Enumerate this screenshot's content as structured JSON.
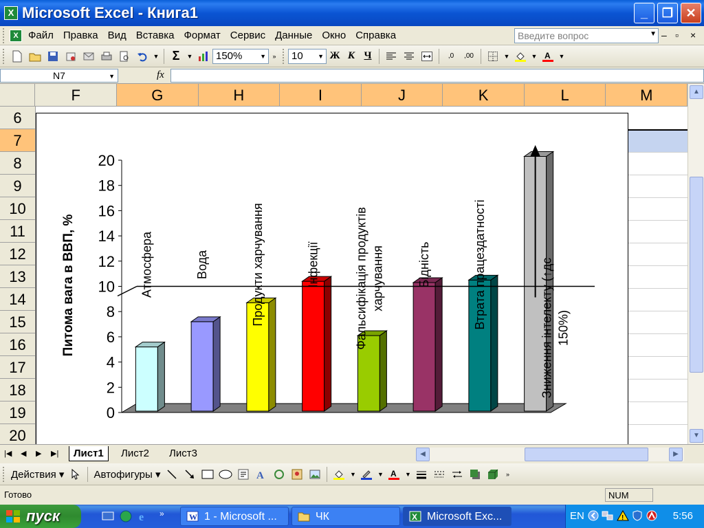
{
  "window": {
    "title": "Microsoft Excel - Книга1",
    "min": "_",
    "max": "❐",
    "close": "✕"
  },
  "menu": {
    "items": [
      "Файл",
      "Правка",
      "Вид",
      "Вставка",
      "Формат",
      "Сервис",
      "Данные",
      "Окно",
      "Справка"
    ],
    "help_placeholder": "Введите вопрос"
  },
  "toolbar": {
    "zoom": "150%",
    "font_size": "10",
    "bold": "Ж",
    "italic": "К",
    "underline": "Ч",
    "sum": "Σ"
  },
  "formula_bar": {
    "name_box": "N7",
    "fx": "fx",
    "formula": ""
  },
  "grid": {
    "columns": [
      "F",
      "G",
      "H",
      "I",
      "J",
      "K",
      "L",
      "M"
    ],
    "rows": [
      "6",
      "7",
      "8",
      "9",
      "10",
      "11",
      "12",
      "13",
      "14",
      "15",
      "16",
      "17",
      "18",
      "19",
      "20"
    ],
    "selected_row": "7"
  },
  "chart_data": {
    "type": "bar",
    "categories": [
      "Атмосфера",
      "Вода",
      "Продукти харчування",
      "Інфекції",
      "Фальсифікація продуктів харчування",
      "Бідність",
      "Втрата працездатності",
      "Зниження інтелекту (↑дс 150%)"
    ],
    "category_label_lines": [
      [
        "Атмосфера"
      ],
      [
        "Вода"
      ],
      [
        "Продукти харчування"
      ],
      [
        "Інфекції"
      ],
      [
        "Фальсифікація продуктів",
        "харчування"
      ],
      [
        "Бідність"
      ],
      [
        "Втрата працездатності"
      ],
      [
        "Зниження інтелекту (↑дс",
        "150%)"
      ]
    ],
    "values": [
      5.2,
      7.2,
      8.7,
      10.4,
      6.1,
      10.3,
      10.5,
      20.3
    ],
    "colors": [
      "#ccffff",
      "#9999ff",
      "#ffff00",
      "#ff0000",
      "#99cc00",
      "#993366",
      "#008080",
      "#c0c0c0"
    ],
    "ylabel": "Питома вага в ВВП, %",
    "ylim": [
      0,
      20
    ],
    "yticks": [
      "0",
      "2",
      "4",
      "6",
      "8",
      "10",
      "12",
      "14",
      "16",
      "18",
      "20"
    ],
    "reference_line": 10,
    "grid": false
  },
  "sheets": {
    "tabs": [
      "Лист1",
      "Лист2",
      "Лист3"
    ],
    "active": "Лист1"
  },
  "drawing_toolbar": {
    "actions": "Действия",
    "autoshapes": "Автофигуры"
  },
  "status": {
    "text": "Готово",
    "num": "NUM"
  },
  "taskbar": {
    "start": "пуск",
    "tasks": [
      "1 - Microsoft ...",
      "ЧК",
      "Microsoft Exc..."
    ],
    "lang": "EN",
    "clock": "5:56"
  }
}
